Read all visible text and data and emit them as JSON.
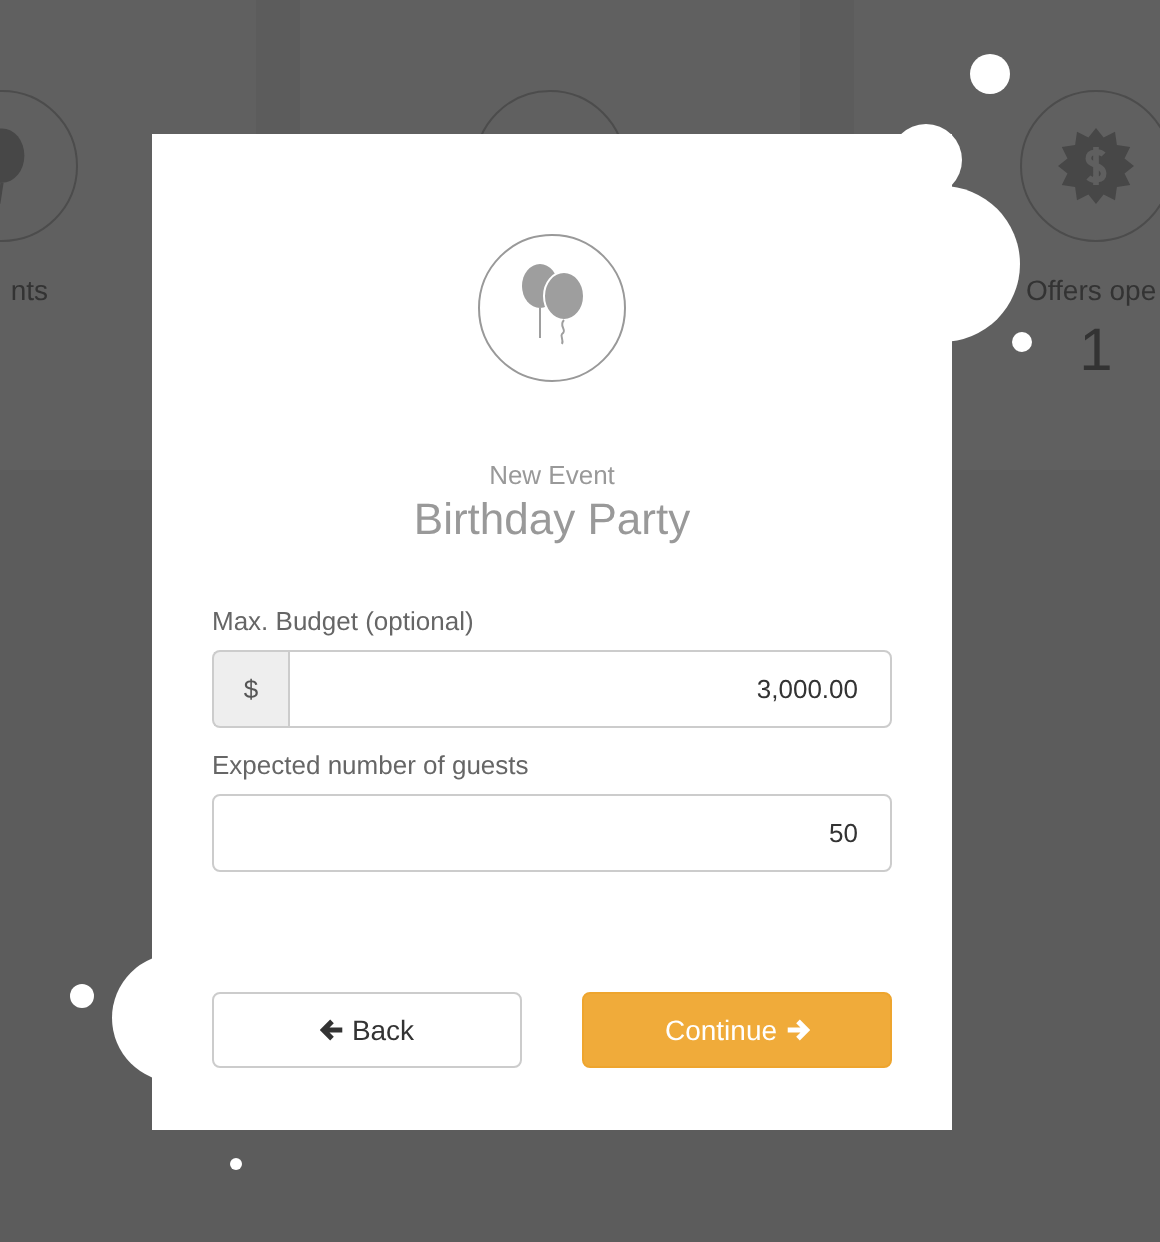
{
  "background_cards": [
    {
      "kind": "balloon",
      "label": "nts"
    },
    {
      "kind": "other"
    },
    {
      "kind": "badge",
      "label": "Offers ope",
      "value": "1"
    }
  ],
  "modal": {
    "subtitle": "New Event",
    "title": "Birthday Party",
    "fields": [
      {
        "label": "Max. Budget (optional)",
        "prefix": "$",
        "value": "3,000.00"
      },
      {
        "label": "Expected number of guests",
        "value": "50"
      }
    ],
    "buttons": [
      {
        "kind": "back",
        "label": "Back"
      },
      {
        "kind": "continue",
        "label": "Continue"
      }
    ]
  }
}
